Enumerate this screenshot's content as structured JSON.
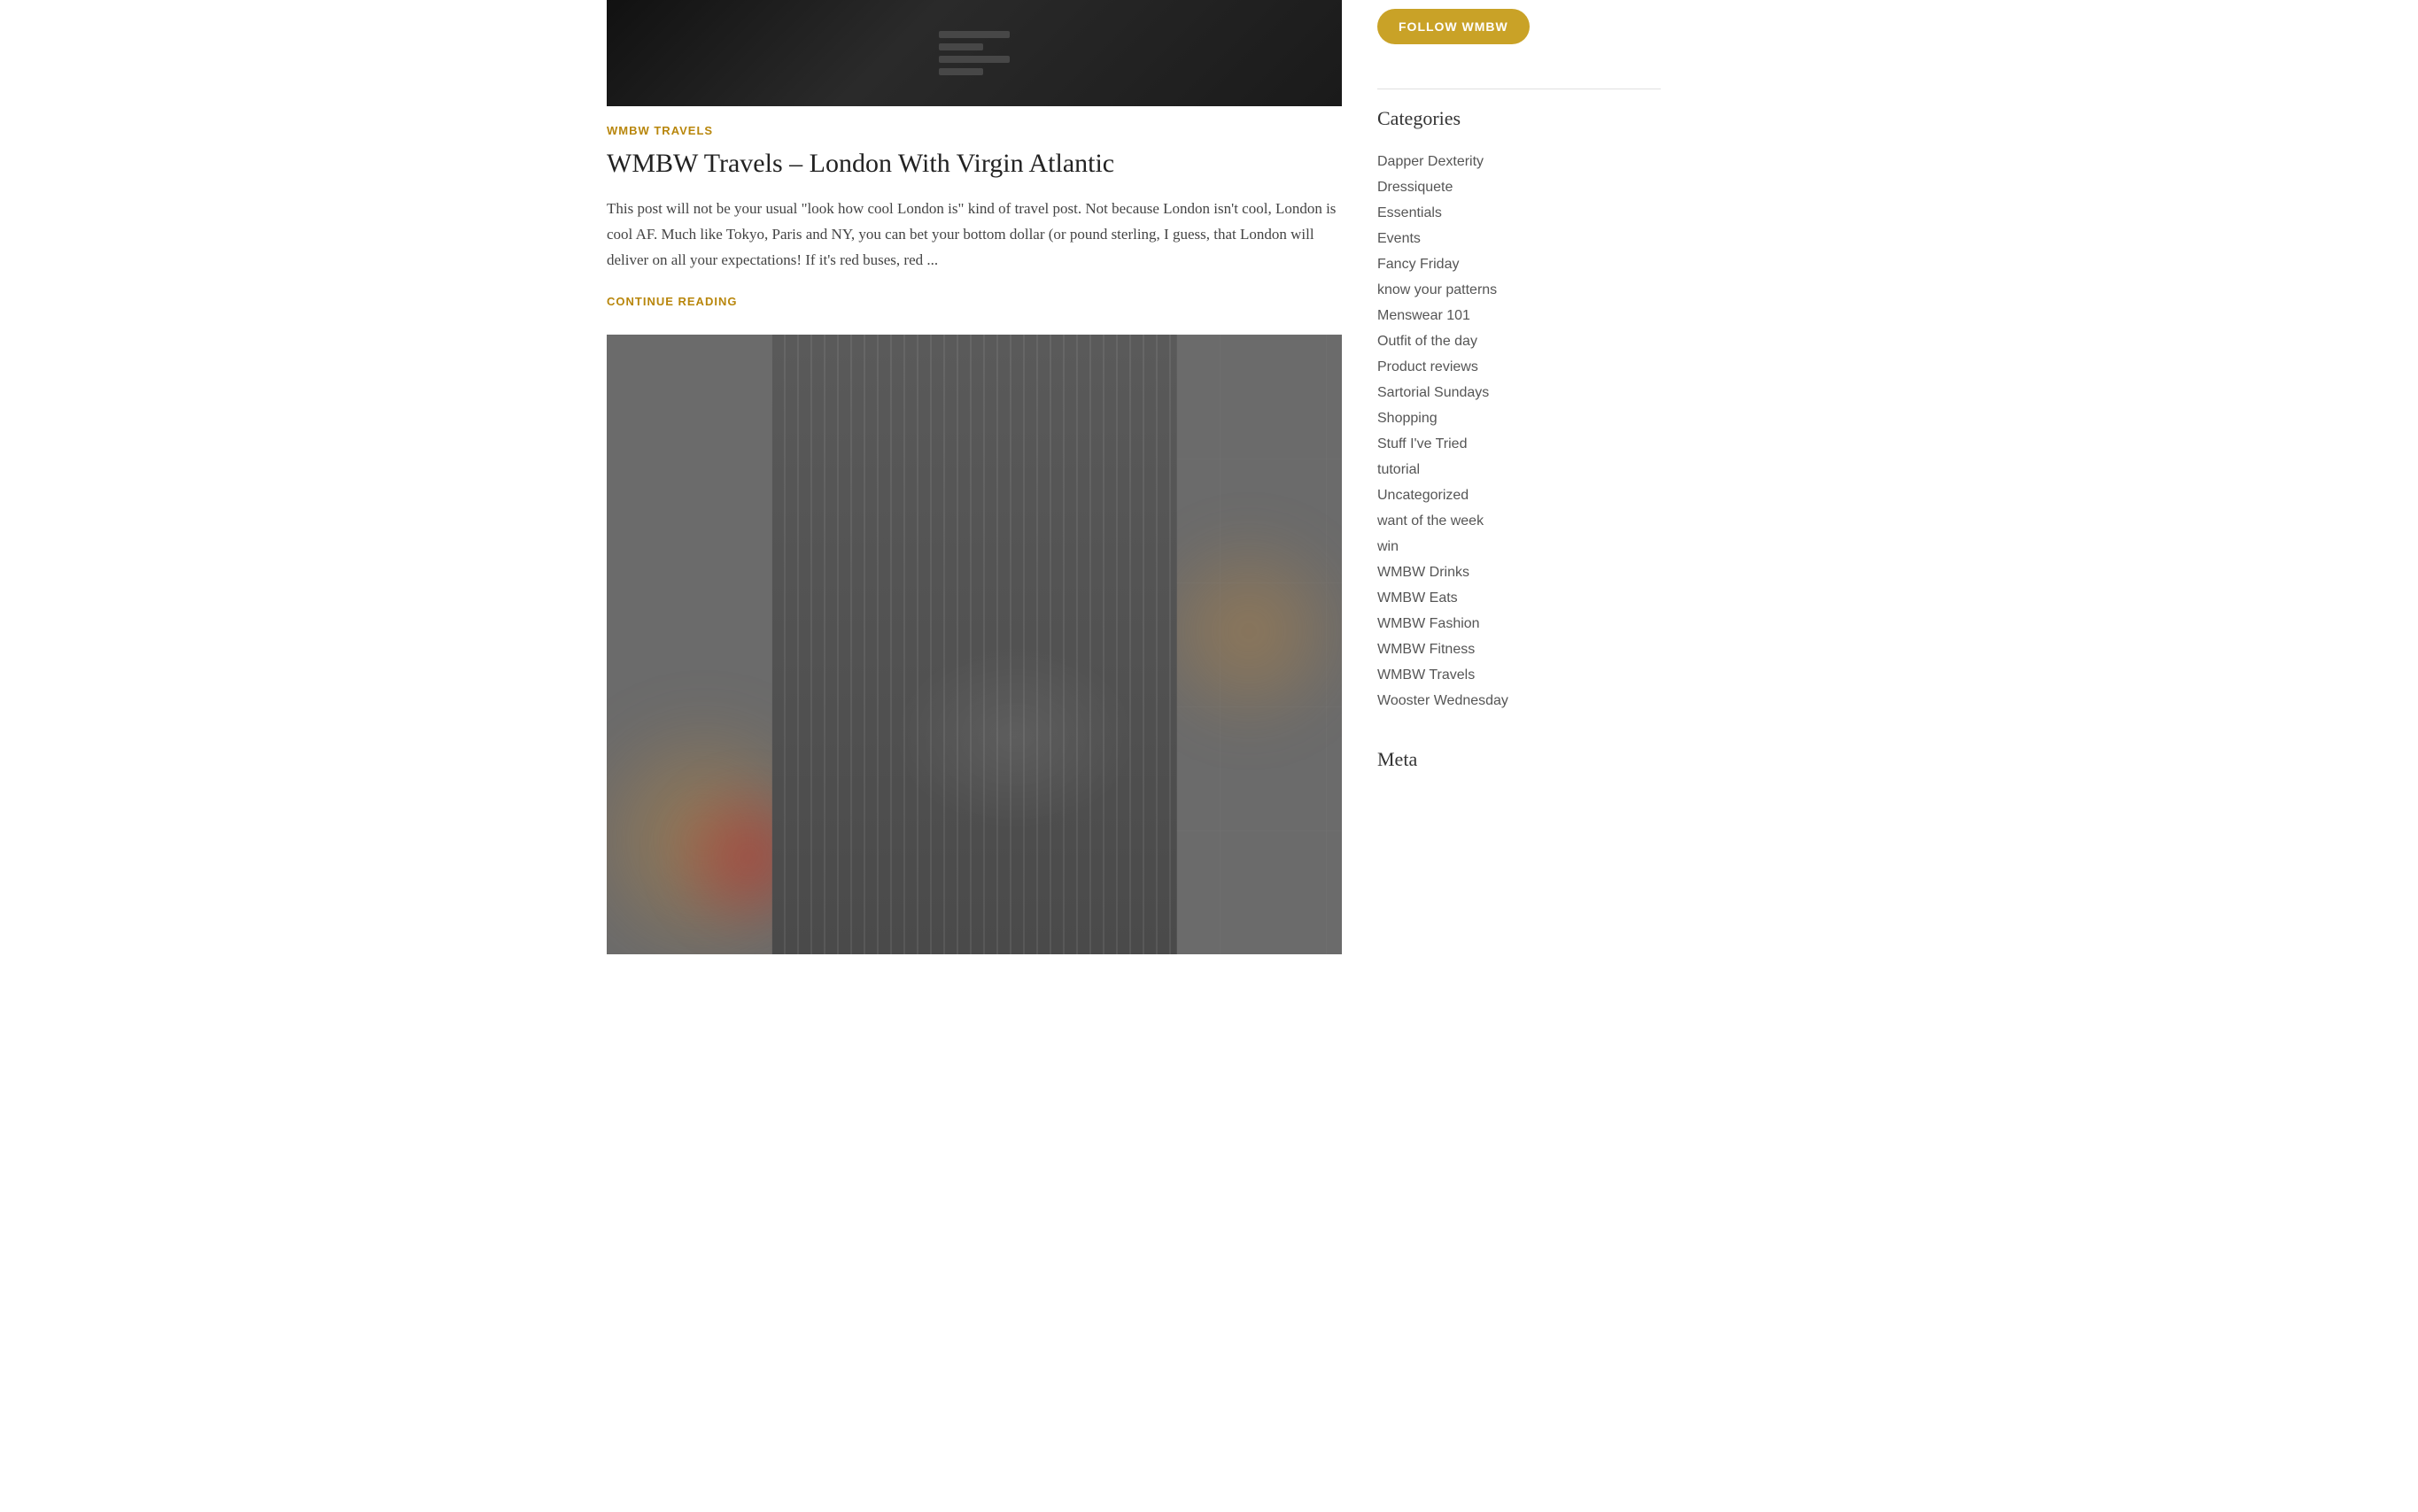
{
  "article": {
    "tag": "WMBW TRAVELS",
    "title": "WMBW Travels – London With Virgin Atlantic",
    "excerpt": "This post will not be your usual \"look how cool London is\" kind of travel post. Not because London isn't cool, London is cool AF.  Much like Tokyo, Paris and NY, you can bet your bottom dollar (or pound sterling, I guess, that London will deliver on all your expectations! If it's red buses, red ...",
    "continue_reading": "CONTINUE READING"
  },
  "sidebar": {
    "follow_button": "FOLLOW WMBW",
    "categories_title": "Categories",
    "categories": [
      "Dapper Dexterity",
      "Dressiquete",
      "Essentials",
      "Events",
      "Fancy Friday",
      "know your patterns",
      "Menswear 101",
      "Outfit of the day",
      "Product reviews",
      "Sartorial Sundays",
      "Shopping",
      "Stuff I've Tried",
      "tutorial",
      "Uncategorized",
      "want of the week",
      "win",
      "WMBW Drinks",
      "WMBW Eats",
      "WMBW Fashion",
      "WMBW Fitness",
      "WMBW Travels",
      "Wooster Wednesday"
    ],
    "meta_title": "Meta"
  }
}
